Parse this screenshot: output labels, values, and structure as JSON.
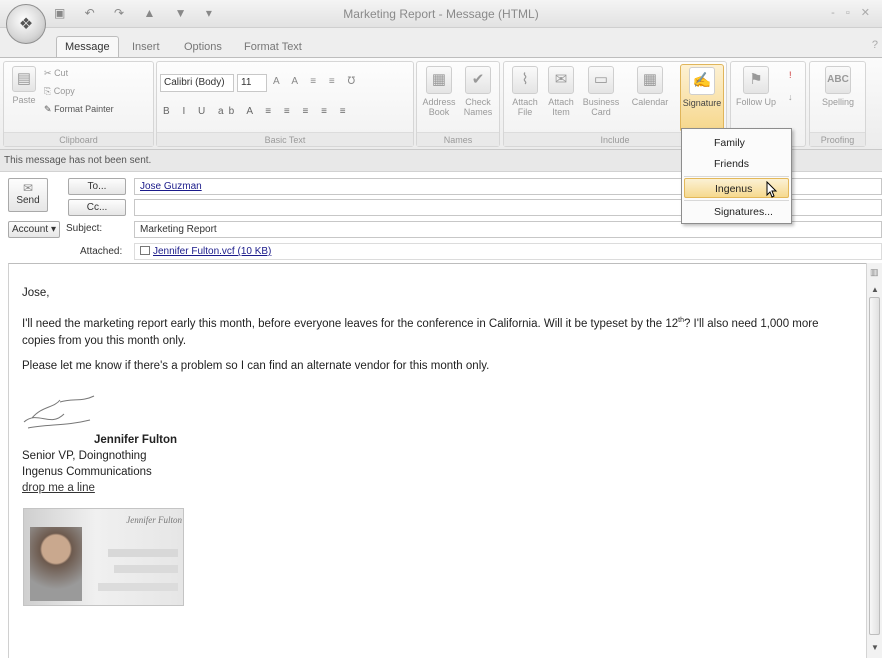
{
  "window": {
    "title": "Marketing Report - Message (HTML)",
    "controls": "- ▫ ✕"
  },
  "quick_access": "▣ ↶ ↷ ▲ ▼ ▾",
  "tabs": [
    "Message",
    "Insert",
    "Options",
    "Format Text"
  ],
  "help": "?",
  "ribbon": {
    "clipboard": {
      "label": "Clipboard",
      "paste": "Paste",
      "cut": "Cut",
      "copy": "Copy",
      "format_painter": "Format Painter"
    },
    "basic_text": {
      "label": "Basic Text",
      "font": "Calibri (Body)",
      "size": "11",
      "controls": "A A ≡ ≡ ℧",
      "format_row": "B I U ab A ≡ ≡ ≡ ≡ ≡"
    },
    "names": {
      "label": "Names",
      "address_book": "Address Book",
      "check_names": "Check Names"
    },
    "include": {
      "label": "Include",
      "attach_file": "Attach File",
      "attach_item": "Attach Item",
      "business_card": "Business Card",
      "calendar": "Calendar",
      "signature": "Signature"
    },
    "options": {
      "follow_up": "Follow Up"
    },
    "proofing": {
      "label": "Proofing",
      "spelling": "Spelling"
    }
  },
  "infobar": "This message has not been sent.",
  "header": {
    "send": "Send",
    "to_button": "To...",
    "to_value": "Jose Guzman",
    "cc_button": "Cc...",
    "cc_value": "",
    "account": "Account",
    "subject_label": "Subject:",
    "subject_value": "Marketing Report",
    "attached_label": "Attached:",
    "attachment": "Jennifer Fulton.vcf (10 KB)"
  },
  "body": {
    "greeting": "Jose,",
    "para1_a": "I'll need the marketing report early this month, before everyone leaves for the conference in California. Will it be typeset by the 12",
    "para1_sup": "th",
    "para1_b": "? I'll also need 1,000 more copies from you this month only.",
    "para2": "Please let me know if there's a problem so I can find an alternate vendor for this month only.",
    "sig_name": "Jennifer Fulton",
    "sig_title": "Senior VP, Doingnothing",
    "sig_company": "Ingenus Communications",
    "sig_link": "drop me a line",
    "card_name": "Jennifer Fulton"
  },
  "signature_menu": [
    "Family",
    "Friends",
    "Ingenus",
    "Signatures..."
  ]
}
